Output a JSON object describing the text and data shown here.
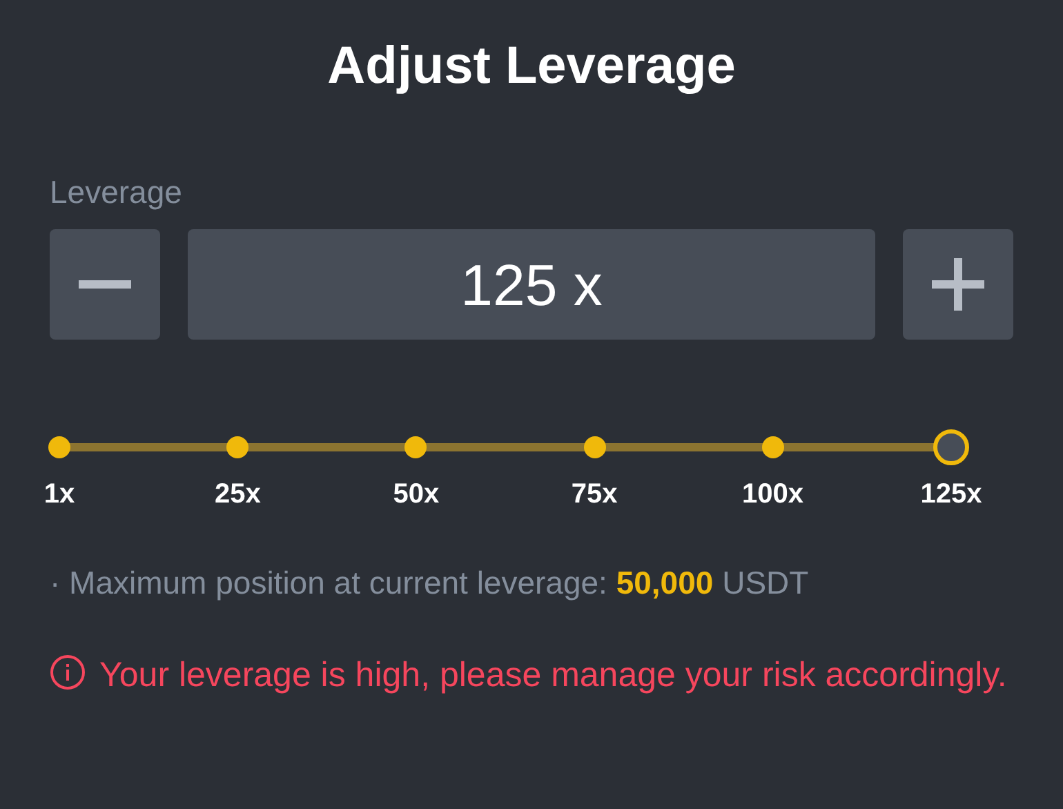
{
  "title": "Adjust Leverage",
  "leverage": {
    "label": "Leverage",
    "value": "125 x"
  },
  "slider": {
    "level": 1,
    "ticks": [
      {
        "label": "1x",
        "selected": false
      },
      {
        "label": "25x",
        "selected": false
      },
      {
        "label": "50x",
        "selected": false
      },
      {
        "label": "75x",
        "selected": false
      },
      {
        "label": "100x",
        "selected": false
      },
      {
        "label": "125x",
        "selected": true
      }
    ]
  },
  "info": "· Maximum position at current leverage: **50,000** USDT",
  "warning": "Your leverage is high, please manage your risk accordingly."
}
